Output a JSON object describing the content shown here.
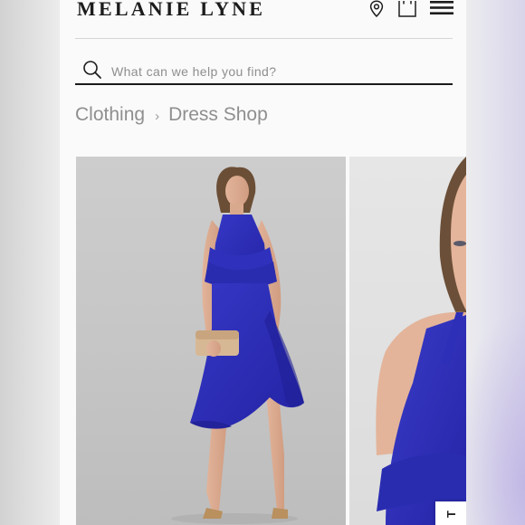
{
  "brand": {
    "logo_text": "MELANIE LYNE"
  },
  "header": {
    "icons": [
      "location-pin-icon",
      "shopping-bag-icon",
      "menu-icon"
    ]
  },
  "search": {
    "placeholder": "What can we help you find?",
    "value": ""
  },
  "breadcrumb": {
    "items": [
      "Clothing",
      "Dress Shop"
    ],
    "separator": "›"
  },
  "gallery": {
    "images": [
      {
        "subject": "model wearing royal blue halter dress with ruffle hem, holding metallic clutch"
      },
      {
        "subject": "close-up of model in royal blue ruffle halter dress"
      }
    ],
    "side_tab_label": "T"
  },
  "colors": {
    "dress_blue": "#2d2fb8",
    "text_dark": "#1c1c1c",
    "breadcrumb_gray": "#8f8f8f"
  }
}
